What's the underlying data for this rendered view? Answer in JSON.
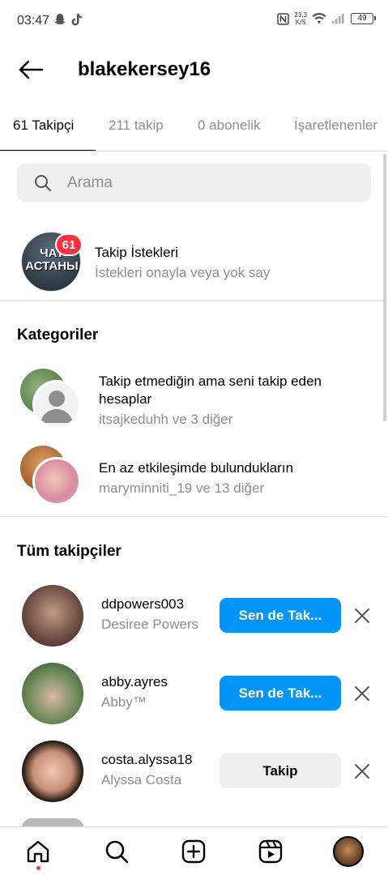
{
  "status_bar": {
    "time": "03:47",
    "net_speed_value": "23,3",
    "net_speed_unit": "K/S",
    "battery": "49"
  },
  "header": {
    "title": "blakekersey16"
  },
  "tabs": [
    {
      "label": "61 Takipçi"
    },
    {
      "label": "211 takip"
    },
    {
      "label": "0 abonelik"
    },
    {
      "label": "İşaretlenenler"
    }
  ],
  "search": {
    "placeholder": "Arama"
  },
  "follow_requests": {
    "avatar_text_line1": "ЧАТ",
    "avatar_text_line2": "АСТАНЫ",
    "badge": "61",
    "title": "Takip İstekleri",
    "subtitle": "İstekleri onayla veya yok say"
  },
  "categories": {
    "heading": "Kategoriler",
    "items": [
      {
        "title": "Takip etmediğin ama seni takip eden hesaplar",
        "subtitle": "itsajkeduhh ve 3 diğer"
      },
      {
        "title": "En az etkileşimde bulundukların",
        "subtitle": "maryminniti_19 ve 13 diğer"
      }
    ]
  },
  "all_followers": {
    "heading": "Tüm takipçiler",
    "items": [
      {
        "username": "ddpowers003",
        "name": "Desiree Powers",
        "button": "Sen de Tak..."
      },
      {
        "username": "abby.ayres",
        "name": "Abby™",
        "button": "Sen de Tak..."
      },
      {
        "username": "costa.alyssa18",
        "name": "Alyssa Costa",
        "button": "Takip"
      }
    ]
  },
  "colors": {
    "primary_button": "#0095f6",
    "secondary_button": "#efefef",
    "badge": "#ff3040",
    "muted_text": "#8e8e8e"
  },
  "icons": {
    "back": "arrow-left-icon",
    "search": "search-icon",
    "remove": "close-icon",
    "nav": [
      "home-icon",
      "search-icon",
      "create-icon",
      "reels-icon",
      "profile-avatar"
    ]
  }
}
